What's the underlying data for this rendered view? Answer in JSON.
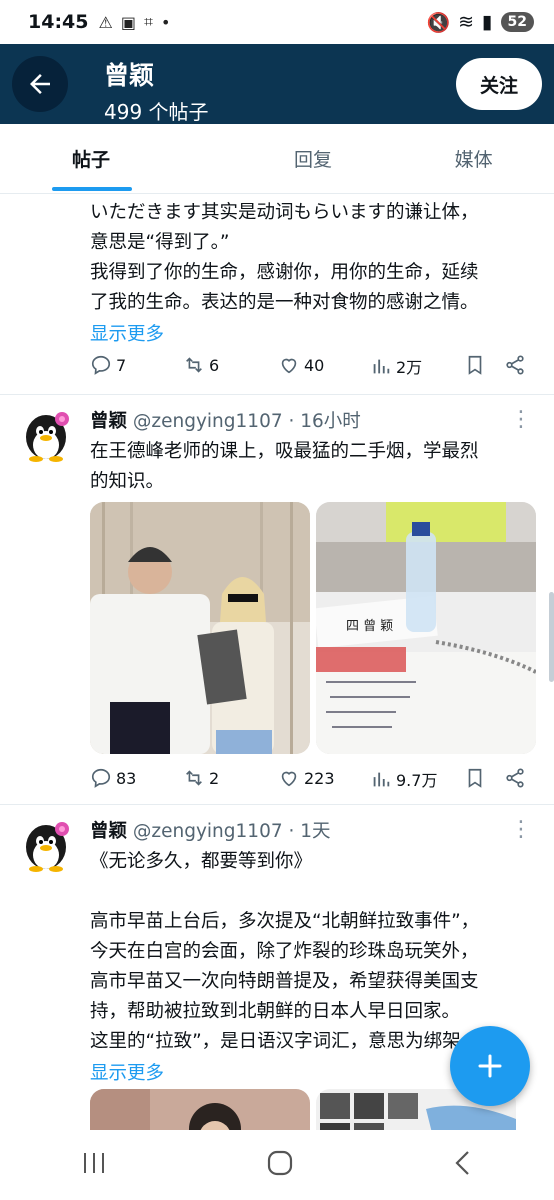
{
  "status_bar": {
    "time": "14:45",
    "battery": "52"
  },
  "header": {
    "name": "曾颖",
    "post_count": "499 个帖子",
    "follow_label": "关注"
  },
  "tabs": [
    {
      "label": "帖子"
    },
    {
      "label": "回复"
    },
    {
      "label": "媒体"
    }
  ],
  "posts": [
    {
      "text_lines": [
        "いただきます其实是动词もらいます的谦让体，",
        "意思是“得到了。”",
        "我得到了你的生命，感谢你，用你的生命，延续",
        "了我的生命。表达的是一种对食物的感谢之情。"
      ],
      "show_more": "显示更多",
      "replies": "7",
      "reposts": "6",
      "likes": "40",
      "views": "2万"
    },
    {
      "name": "曾颖",
      "handle": "@zengying1107",
      "time": "· 16小时",
      "text_lines": [
        "在王德峰老师的课上，吸最猛的二手烟，学最烈",
        "的知识。"
      ],
      "replies": "83",
      "reposts": "2",
      "likes": "223",
      "views": "9.7万"
    },
    {
      "name": "曾颖",
      "handle": "@zengying1107",
      "time": "· 1天",
      "text_lines": [
        "《无论多久，都要等到你》",
        "",
        "高市早苗上台后，多次提及“北朝鲜拉致事件”，",
        "今天在白宫的会面，除了炸裂的珍珠岛玩笑外，",
        "高市早苗又一次向特朗普提及，希望获得美国支",
        "持，帮助被拉致到北朝鲜的日本人早日回家。",
        "这里的“拉致”，是日语汉字词汇，意思为绑架"
      ],
      "show_more": "显示更多"
    }
  ],
  "colors": {
    "header_bg": "#0c3552",
    "accent": "#1d9bf0"
  }
}
